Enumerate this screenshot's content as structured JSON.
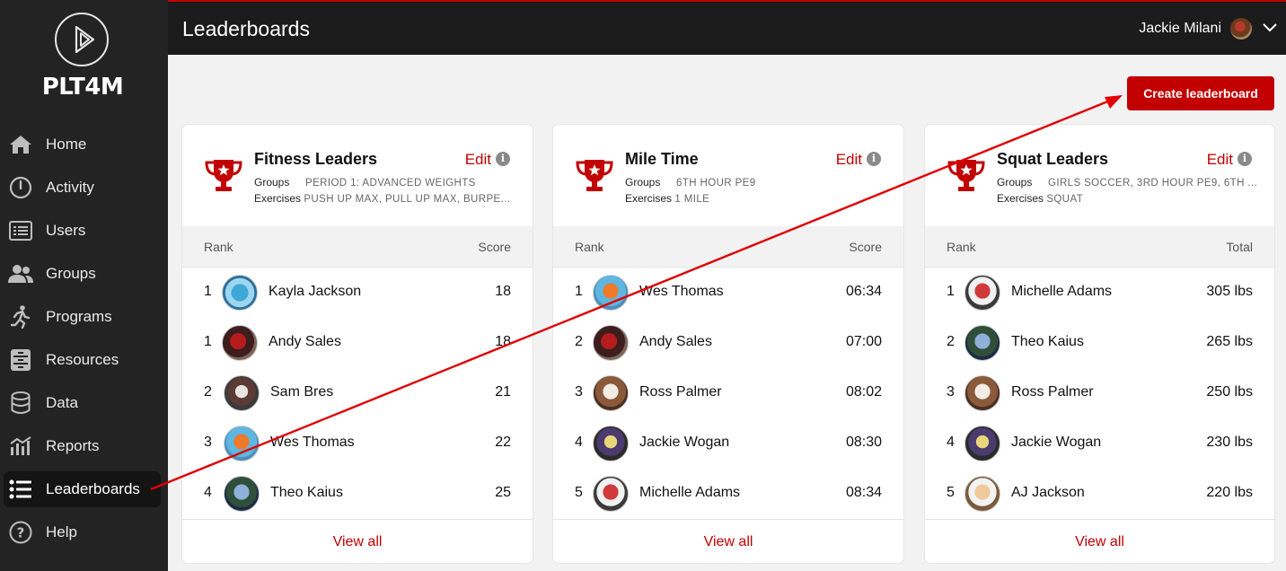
{
  "app": {
    "brand": "PLT4M",
    "page_title": "Leaderboards"
  },
  "user": {
    "name": "Jackie Milani"
  },
  "sidebar": {
    "items": [
      {
        "label": "Home",
        "icon": "home-icon"
      },
      {
        "label": "Activity",
        "icon": "activity-icon"
      },
      {
        "label": "Users",
        "icon": "users-icon"
      },
      {
        "label": "Groups",
        "icon": "groups-icon"
      },
      {
        "label": "Programs",
        "icon": "programs-icon"
      },
      {
        "label": "Resources",
        "icon": "resources-icon"
      },
      {
        "label": "Data",
        "icon": "data-icon"
      },
      {
        "label": "Reports",
        "icon": "reports-icon"
      },
      {
        "label": "Leaderboards",
        "icon": "leaderboards-icon",
        "active": true
      },
      {
        "label": "Help",
        "icon": "help-icon"
      }
    ]
  },
  "actions": {
    "create_label": "Create leaderboard"
  },
  "cards": [
    {
      "title": "Fitness Leaders",
      "edit_label": "Edit",
      "groups_key": "Groups",
      "groups_value": "PERIOD 1: ADVANCED WEIGHTS",
      "exercises_key": "Exercises",
      "exercises_value": "PUSH UP MAX, PULL UP MAX, BURPE...",
      "rank_header": "Rank",
      "score_header": "Score",
      "rows": [
        {
          "rank": "1",
          "name": "Kayla Jackson",
          "score": "18"
        },
        {
          "rank": "1",
          "name": "Andy Sales",
          "score": "18"
        },
        {
          "rank": "2",
          "name": "Sam Bres",
          "score": "21"
        },
        {
          "rank": "3",
          "name": "Wes Thomas",
          "score": "22"
        },
        {
          "rank": "4",
          "name": "Theo Kaius",
          "score": "25"
        }
      ],
      "view_all": "View all"
    },
    {
      "title": "Mile Time",
      "edit_label": "Edit",
      "groups_key": "Groups",
      "groups_value": "6TH HOUR PE9",
      "exercises_key": "Exercises",
      "exercises_value": "1 MILE",
      "rank_header": "Rank",
      "score_header": "Score",
      "rows": [
        {
          "rank": "1",
          "name": "Wes Thomas",
          "score": "06:34"
        },
        {
          "rank": "2",
          "name": "Andy Sales",
          "score": "07:00"
        },
        {
          "rank": "3",
          "name": "Ross Palmer",
          "score": "08:02"
        },
        {
          "rank": "4",
          "name": "Jackie Wogan",
          "score": "08:30"
        },
        {
          "rank": "5",
          "name": "Michelle Adams",
          "score": "08:34"
        }
      ],
      "view_all": "View all"
    },
    {
      "title": "Squat Leaders",
      "edit_label": "Edit",
      "groups_key": "Groups",
      "groups_value": "GIRLS SOCCER, 3RD HOUR PE9, 6TH ...",
      "exercises_key": "Exercises",
      "exercises_value": "SQUAT",
      "rank_header": "Rank",
      "score_header": "Total",
      "rows": [
        {
          "rank": "1",
          "name": "Michelle Adams",
          "score": "305 lbs"
        },
        {
          "rank": "2",
          "name": "Theo Kaius",
          "score": "265 lbs"
        },
        {
          "rank": "3",
          "name": "Ross Palmer",
          "score": "250 lbs"
        },
        {
          "rank": "4",
          "name": "Jackie Wogan",
          "score": "230 lbs"
        },
        {
          "rank": "5",
          "name": "AJ Jackson",
          "score": "220 lbs"
        }
      ],
      "view_all": "View all"
    }
  ],
  "colors": {
    "accent": "#c20000",
    "sidebar_bg": "#232323",
    "topbar_bg": "#1b1b1b",
    "annotation_arrow": "#e00000"
  }
}
